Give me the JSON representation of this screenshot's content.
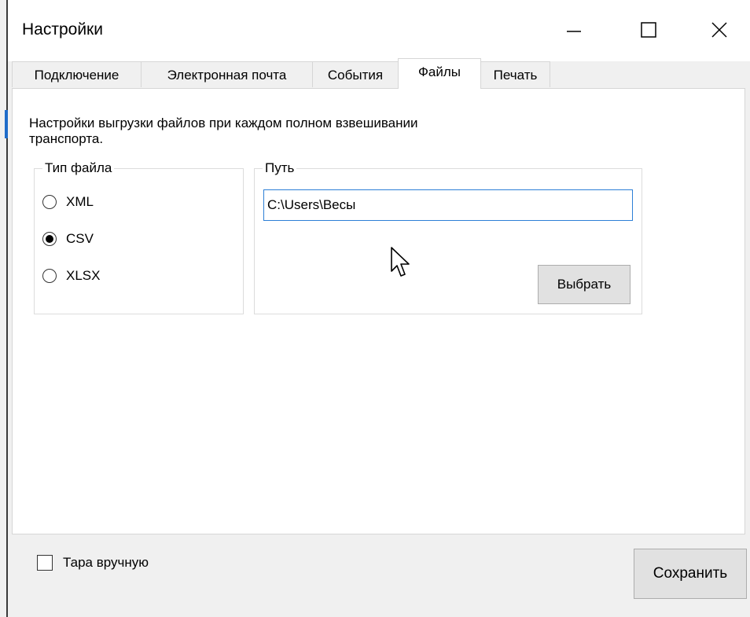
{
  "window": {
    "title": "Настройки",
    "controls": {
      "minimize_icon": "minimize-icon",
      "maximize_icon": "maximize-icon",
      "close_icon": "close-icon"
    }
  },
  "tabs": [
    {
      "label": "Подключение",
      "active": false
    },
    {
      "label": "Электронная почта",
      "active": false
    },
    {
      "label": "События",
      "active": false
    },
    {
      "label": "Файлы",
      "active": true
    },
    {
      "label": "Печать",
      "active": false
    }
  ],
  "files_tab": {
    "description": "Настройки выгрузки файлов при каждом полном взвешивании транспорта.",
    "file_type_group": {
      "legend": "Тип файла",
      "options": [
        {
          "label": "XML",
          "selected": false
        },
        {
          "label": "CSV",
          "selected": true
        },
        {
          "label": "XLSX",
          "selected": false
        }
      ]
    },
    "path_group": {
      "legend": "Путь",
      "path_value": "C:\\Users\\Весы",
      "choose_button": "Выбрать"
    }
  },
  "footer": {
    "manual_tare_label": "Тара вручную",
    "manual_tare_checked": false,
    "save_button": "Сохранить"
  },
  "colors": {
    "window_bg": "#f0f0f0",
    "panel_bg": "#ffffff",
    "input_focus_border": "#2d7fd6",
    "button_bg": "#e1e1e1"
  }
}
